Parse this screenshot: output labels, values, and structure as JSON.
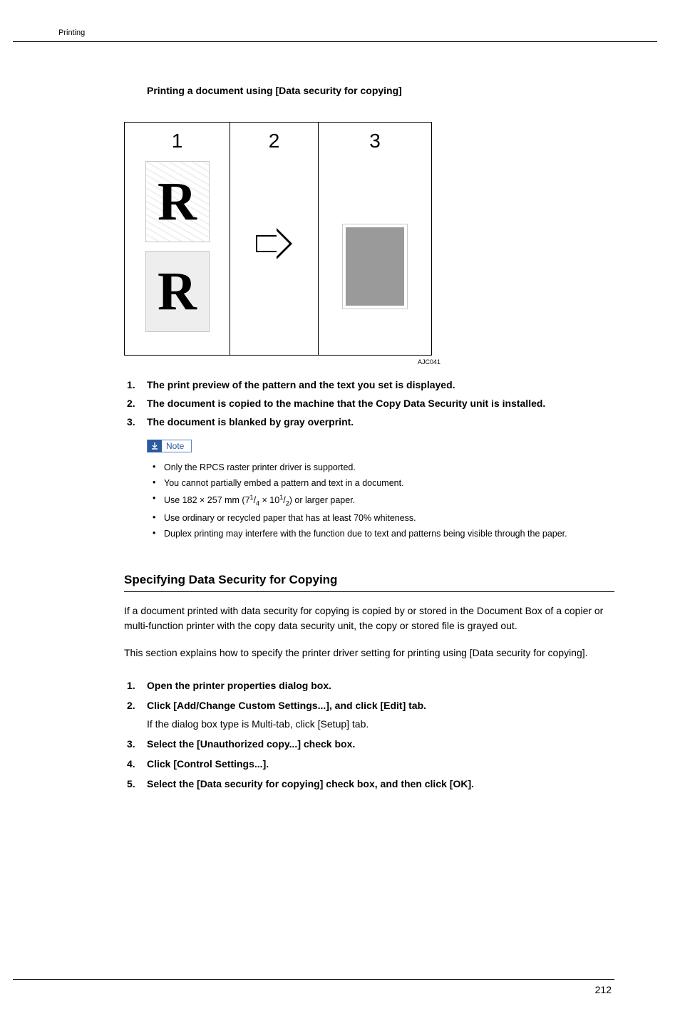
{
  "header": {
    "section": "Printing"
  },
  "figure": {
    "heading": "Printing a document using [Data security for copying]",
    "labels": {
      "p1": "1",
      "p2": "2",
      "p3": "3"
    },
    "glyph": "R",
    "code": "AJC041"
  },
  "figlist": [
    "The print preview of the pattern and the text you set is displayed.",
    "The document is copied to the machine that the Copy Data Security unit is installed.",
    "The document is blanked by gray overprint."
  ],
  "note": {
    "label": "Note",
    "items": [
      "Only the RPCS raster printer driver is supported.",
      "You cannot partially embed a pattern and text in a document.",
      "__PAPER_SIZE__",
      "Use ordinary or recycled paper that has at least 70% whiteness.",
      "Duplex printing may interfere with the function due to text and patterns being visible through the paper."
    ],
    "paper": {
      "prefix": "Use 182 × 257 mm (7",
      "n1": "1",
      "d1": "4",
      "mid": " × 10",
      "n2": "1",
      "d2": "2",
      "suffix": ") or larger paper."
    }
  },
  "section2": {
    "heading": "Specifying Data Security for Copying",
    "p1": "If a document printed with data security for copying is copied by or stored in the Document Box of a copier or multi-function printer with the copy data security unit, the copy or stored file is grayed out.",
    "p2": "This section explains how to specify the printer driver setting for printing using [Data security for copying]."
  },
  "steps": [
    {
      "main": "Open the printer properties dialog box."
    },
    {
      "main": "Click [Add/Change Custom Settings...], and click [Edit] tab.",
      "note": "If the dialog box type is Multi-tab, click [Setup] tab."
    },
    {
      "main": "Select the [Unauthorized copy...] check box."
    },
    {
      "main": "Click [Control Settings...]."
    },
    {
      "main": "Select the [Data security for copying] check box, and then click [OK]."
    }
  ],
  "pagenum": "212"
}
